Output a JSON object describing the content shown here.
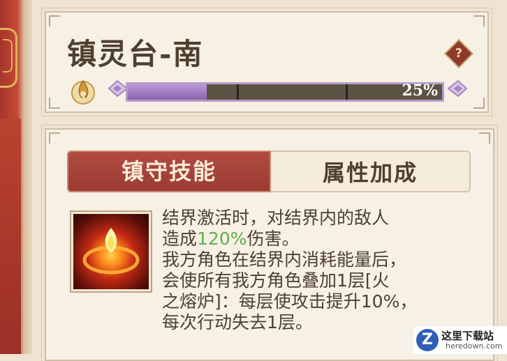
{
  "header": {
    "title": "镇灵台-南",
    "help_label": "?"
  },
  "progress": {
    "value": 0.25,
    "label": "25%",
    "fill_color": "#9a78c0"
  },
  "tabs": [
    {
      "label": "镇守技能",
      "active": true
    },
    {
      "label": "属性加成",
      "active": false
    }
  ],
  "skill": {
    "icon": "fire-ring-icon",
    "desc_lines": [
      {
        "parts": [
          "结界激活时，对结界内的敌人"
        ]
      },
      {
        "parts": [
          "造成",
          "120%",
          "伤害。"
        ]
      },
      {
        "parts": [
          "我方角色在结界内消耗能量后，"
        ]
      },
      {
        "parts": [
          "会使所有我方角色叠加1层[火"
        ]
      },
      {
        "parts": [
          "之熔炉]：每层使攻击提升10%，"
        ]
      },
      {
        "parts": [
          "每次行动失去1层。"
        ]
      }
    ],
    "highlight_color": "#5bb04a"
  },
  "watermark": {
    "name": "这里下载站",
    "url": "heredown.com",
    "logo_letter": "Z"
  }
}
